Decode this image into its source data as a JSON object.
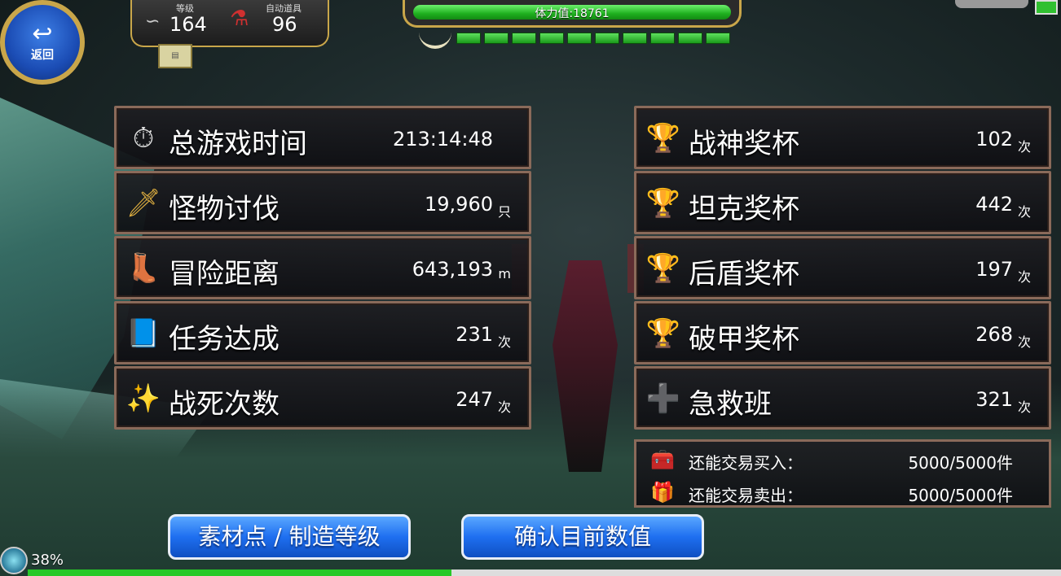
{
  "hud": {
    "back_label": "返回",
    "level_label": "等级",
    "level_value": "164",
    "auto_item_label": "自动道具",
    "auto_item_value": "96",
    "stamina_text": "体力值:18761",
    "stamina_segments": 10
  },
  "left_stats": [
    {
      "icon": "stopwatch-icon",
      "label": "总游戏时间",
      "value": "213:14:48",
      "unit": ""
    },
    {
      "icon": "sword-icon",
      "label": "怪物讨伐",
      "value": "19,960",
      "unit": "只"
    },
    {
      "icon": "boot-icon",
      "label": "冒险距离",
      "value": "643,193",
      "unit": "m"
    },
    {
      "icon": "book-icon",
      "label": "任务达成",
      "value": "231",
      "unit": "次"
    },
    {
      "icon": "stars-icon",
      "label": "战死次数",
      "value": "247",
      "unit": "次"
    }
  ],
  "right_stats": [
    {
      "icon": "trophy-icon",
      "label": "战神奖杯",
      "value": "102",
      "unit": "次"
    },
    {
      "icon": "trophy-icon",
      "label": "坦克奖杯",
      "value": "442",
      "unit": "次"
    },
    {
      "icon": "trophy-icon",
      "label": "后盾奖杯",
      "value": "197",
      "unit": "次"
    },
    {
      "icon": "trophy-icon",
      "label": "破甲奖杯",
      "value": "268",
      "unit": "次"
    },
    {
      "icon": "first-aid-icon",
      "label": "急救班",
      "value": "321",
      "unit": "次"
    }
  ],
  "trade": {
    "buy_label": "还能交易买入：",
    "buy_value": "5000/5000件",
    "sell_label": "还能交易卖出：",
    "sell_value": "5000/5000件"
  },
  "buttons": {
    "materials": "素材点 / 制造等级",
    "confirm": "确认目前数值"
  },
  "footer": {
    "progress_text": "38%",
    "progress": 0.38
  }
}
